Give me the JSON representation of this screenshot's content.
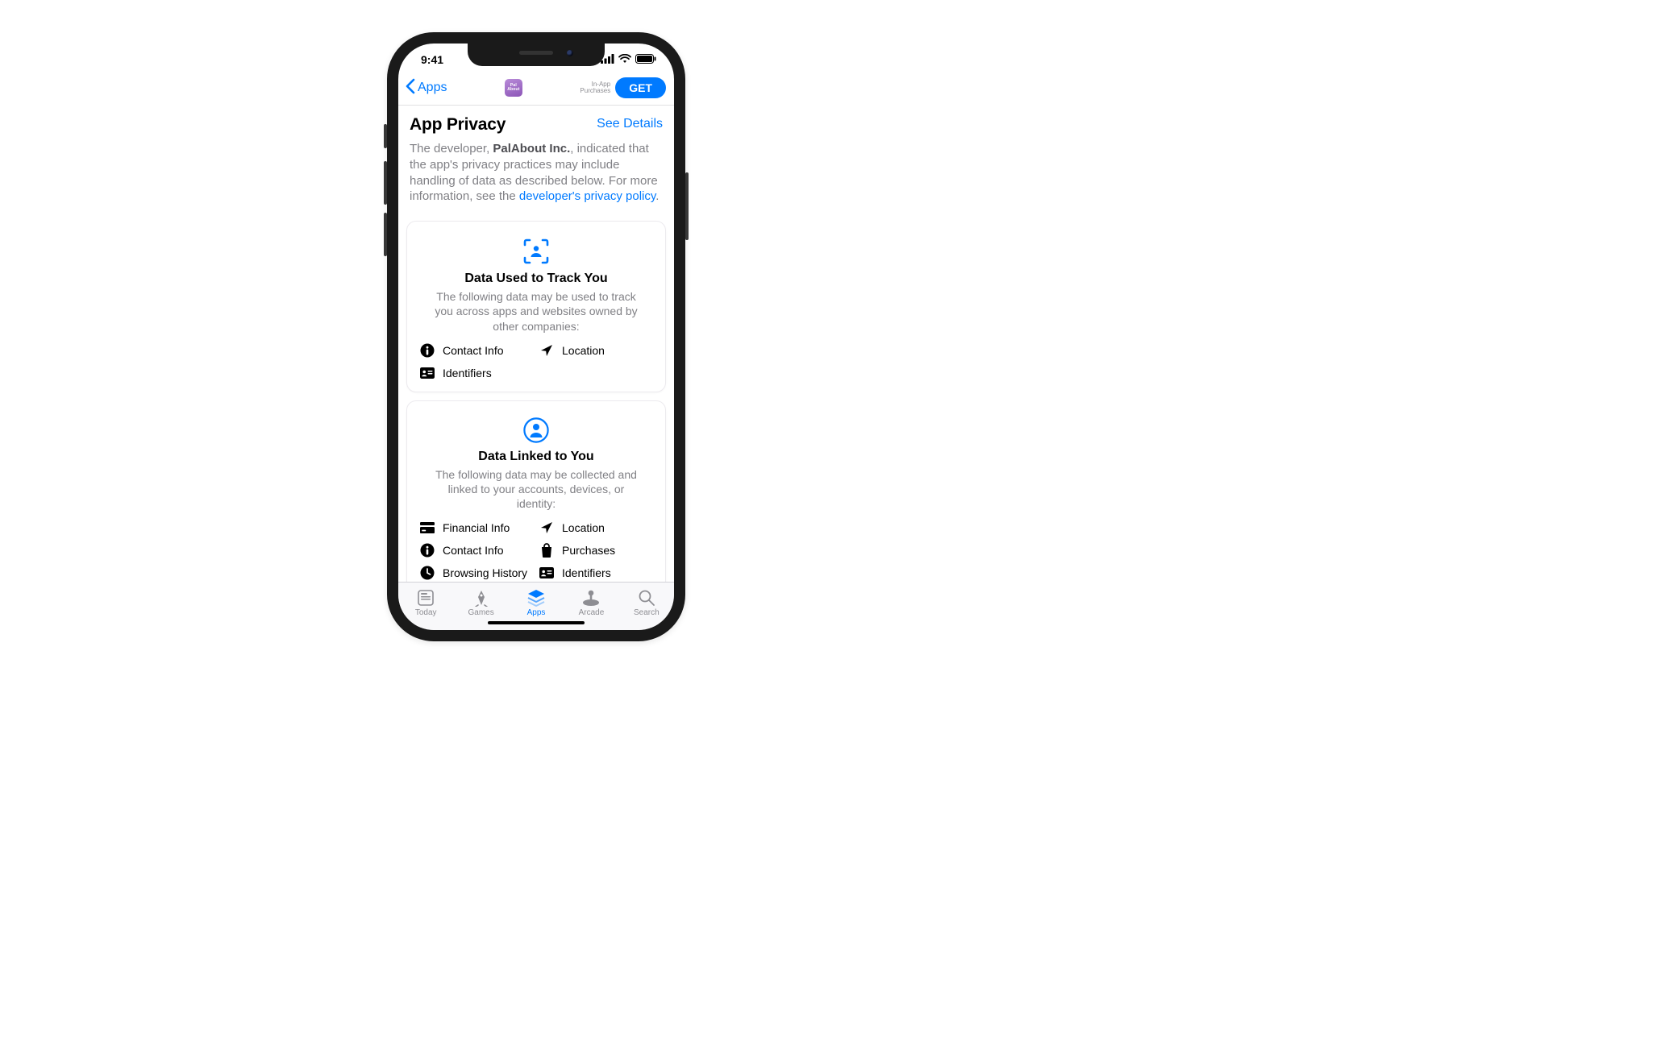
{
  "status": {
    "time": "9:41"
  },
  "header": {
    "back_label": "Apps",
    "app_icon_label": "Pal About",
    "iap_line1": "In-App",
    "iap_line2": "Purchases",
    "get_label": "GET"
  },
  "privacy": {
    "title": "App Privacy",
    "see_details": "See Details",
    "blurb_prefix": "The developer, ",
    "developer_name": "PalAbout Inc.",
    "blurb_mid": ", indicated that the app's privacy practices may include handling of data as described below. For more information, see the ",
    "policy_link_text": "developer's privacy policy",
    "blurb_suffix": "."
  },
  "cards": {
    "track": {
      "title": "Data Used to Track You",
      "desc": "The following data may be used to track you across apps and websites owned by other companies:",
      "items": [
        "Contact Info",
        "Location",
        "Identifiers"
      ]
    },
    "linked": {
      "title": "Data Linked to You",
      "desc": "The following data may be collected and linked to your accounts, devices, or identity:",
      "items": [
        "Financial Info",
        "Location",
        "Contact Info",
        "Purchases",
        "Browsing History",
        "Identifiers"
      ]
    }
  },
  "tabs": {
    "today": "Today",
    "games": "Games",
    "apps": "Apps",
    "arcade": "Arcade",
    "search": "Search"
  }
}
